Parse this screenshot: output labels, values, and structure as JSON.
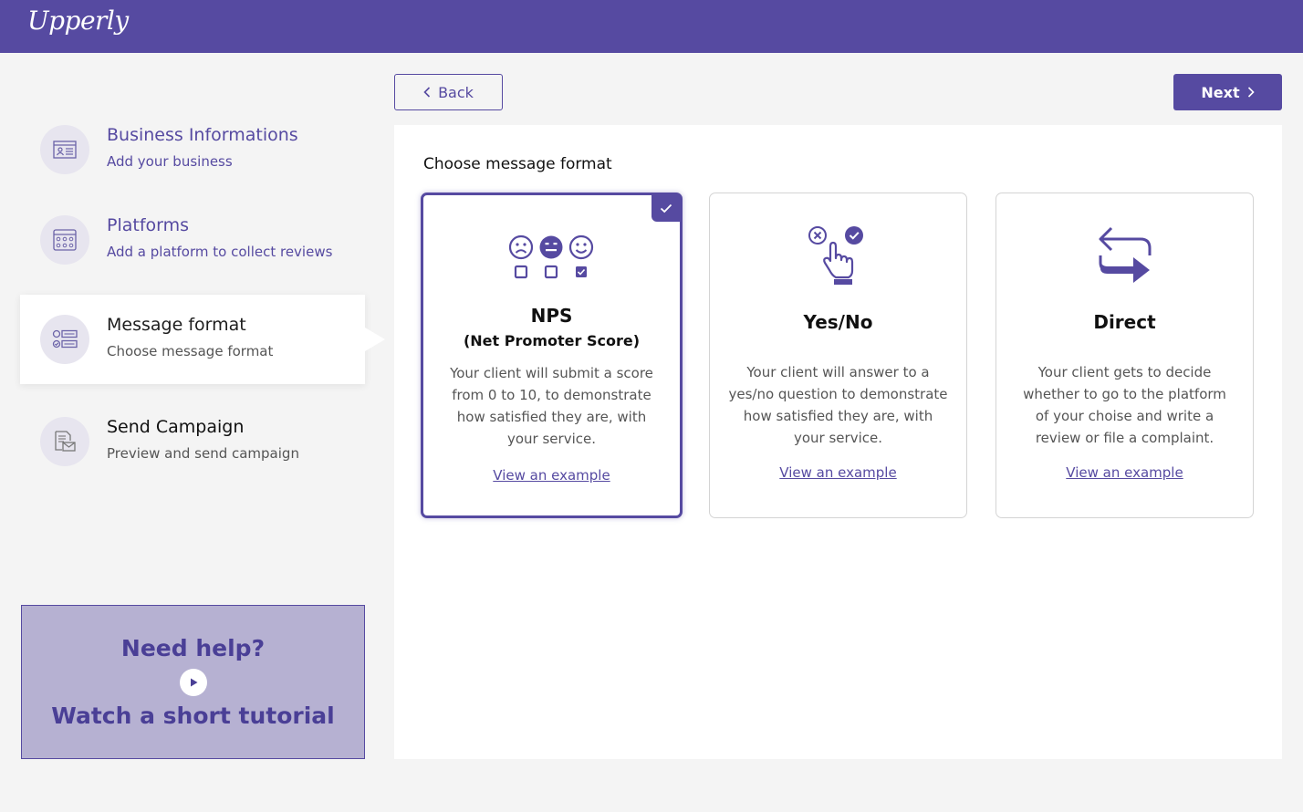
{
  "header": {
    "logo_text": "Upperly",
    "bg_color": "#564aa1"
  },
  "steps": [
    {
      "title": "Business Informations",
      "subtitle": "Add your business",
      "icon": "id-card-icon",
      "state": "done"
    },
    {
      "title": "Platforms",
      "subtitle": "Add a platform to collect reviews",
      "icon": "platform-grid-icon",
      "state": "done"
    },
    {
      "title": "Message format",
      "subtitle": "Choose message format",
      "icon": "format-options-icon",
      "state": "active"
    },
    {
      "title": "Send Campaign",
      "subtitle": "Preview and send campaign",
      "icon": "send-document-icon",
      "state": "pending"
    }
  ],
  "help": {
    "title": "Need help?",
    "subtitle": "Watch a short tutorial",
    "icon": "play-icon"
  },
  "nav": {
    "back_label": "Back",
    "next_label": "Next"
  },
  "main": {
    "title": "Choose message format",
    "options": [
      {
        "name": "NPS",
        "subname": "(Net Promoter Score)",
        "description": "Your client will submit a score from 0 to 10, to demonstrate how satisfied they are, with your service.",
        "link": "View an example",
        "icon": "smiley-rating-icon",
        "selected": true
      },
      {
        "name": "Yes/No",
        "subname": "",
        "description": "Your client will answer to a yes/no question to demonstrate how satisfied they are, with your service.",
        "link": "View an example",
        "icon": "hand-pointer-icon",
        "selected": false
      },
      {
        "name": "Direct",
        "subname": "",
        "description": "Your client gets to decide whether to go to the platform of your choise and write a review or file a complaint.",
        "link": "View an example",
        "icon": "swap-arrows-icon",
        "selected": false
      }
    ]
  },
  "colors": {
    "accent": "#564aa1",
    "help_bg": "#b6b1d2",
    "page_bg": "#f4f4f4"
  }
}
